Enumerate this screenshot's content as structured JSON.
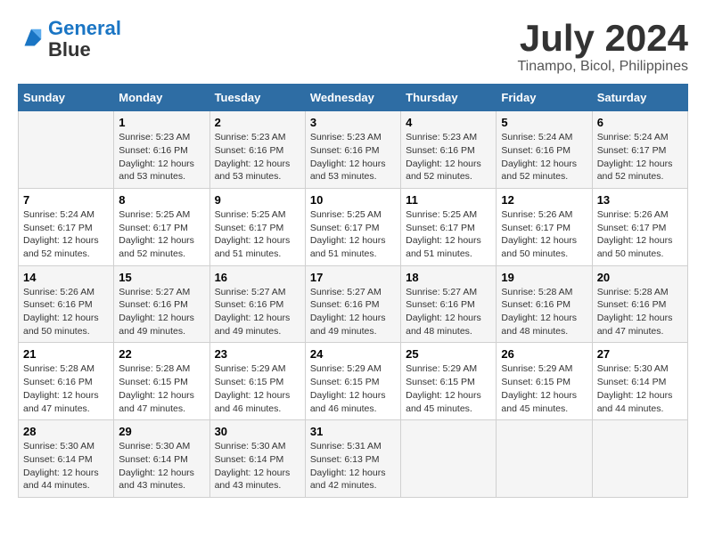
{
  "header": {
    "logo_line1": "General",
    "logo_line2": "Blue",
    "month": "July 2024",
    "location": "Tinampo, Bicol, Philippines"
  },
  "columns": [
    "Sunday",
    "Monday",
    "Tuesday",
    "Wednesday",
    "Thursday",
    "Friday",
    "Saturday"
  ],
  "weeks": [
    [
      {
        "day": "",
        "sunrise": "",
        "sunset": "",
        "daylight": ""
      },
      {
        "day": "1",
        "sunrise": "Sunrise: 5:23 AM",
        "sunset": "Sunset: 6:16 PM",
        "daylight": "Daylight: 12 hours and 53 minutes."
      },
      {
        "day": "2",
        "sunrise": "Sunrise: 5:23 AM",
        "sunset": "Sunset: 6:16 PM",
        "daylight": "Daylight: 12 hours and 53 minutes."
      },
      {
        "day": "3",
        "sunrise": "Sunrise: 5:23 AM",
        "sunset": "Sunset: 6:16 PM",
        "daylight": "Daylight: 12 hours and 53 minutes."
      },
      {
        "day": "4",
        "sunrise": "Sunrise: 5:23 AM",
        "sunset": "Sunset: 6:16 PM",
        "daylight": "Daylight: 12 hours and 52 minutes."
      },
      {
        "day": "5",
        "sunrise": "Sunrise: 5:24 AM",
        "sunset": "Sunset: 6:16 PM",
        "daylight": "Daylight: 12 hours and 52 minutes."
      },
      {
        "day": "6",
        "sunrise": "Sunrise: 5:24 AM",
        "sunset": "Sunset: 6:17 PM",
        "daylight": "Daylight: 12 hours and 52 minutes."
      }
    ],
    [
      {
        "day": "7",
        "sunrise": "Sunrise: 5:24 AM",
        "sunset": "Sunset: 6:17 PM",
        "daylight": "Daylight: 12 hours and 52 minutes."
      },
      {
        "day": "8",
        "sunrise": "Sunrise: 5:25 AM",
        "sunset": "Sunset: 6:17 PM",
        "daylight": "Daylight: 12 hours and 52 minutes."
      },
      {
        "day": "9",
        "sunrise": "Sunrise: 5:25 AM",
        "sunset": "Sunset: 6:17 PM",
        "daylight": "Daylight: 12 hours and 51 minutes."
      },
      {
        "day": "10",
        "sunrise": "Sunrise: 5:25 AM",
        "sunset": "Sunset: 6:17 PM",
        "daylight": "Daylight: 12 hours and 51 minutes."
      },
      {
        "day": "11",
        "sunrise": "Sunrise: 5:25 AM",
        "sunset": "Sunset: 6:17 PM",
        "daylight": "Daylight: 12 hours and 51 minutes."
      },
      {
        "day": "12",
        "sunrise": "Sunrise: 5:26 AM",
        "sunset": "Sunset: 6:17 PM",
        "daylight": "Daylight: 12 hours and 50 minutes."
      },
      {
        "day": "13",
        "sunrise": "Sunrise: 5:26 AM",
        "sunset": "Sunset: 6:17 PM",
        "daylight": "Daylight: 12 hours and 50 minutes."
      }
    ],
    [
      {
        "day": "14",
        "sunrise": "Sunrise: 5:26 AM",
        "sunset": "Sunset: 6:16 PM",
        "daylight": "Daylight: 12 hours and 50 minutes."
      },
      {
        "day": "15",
        "sunrise": "Sunrise: 5:27 AM",
        "sunset": "Sunset: 6:16 PM",
        "daylight": "Daylight: 12 hours and 49 minutes."
      },
      {
        "day": "16",
        "sunrise": "Sunrise: 5:27 AM",
        "sunset": "Sunset: 6:16 PM",
        "daylight": "Daylight: 12 hours and 49 minutes."
      },
      {
        "day": "17",
        "sunrise": "Sunrise: 5:27 AM",
        "sunset": "Sunset: 6:16 PM",
        "daylight": "Daylight: 12 hours and 49 minutes."
      },
      {
        "day": "18",
        "sunrise": "Sunrise: 5:27 AM",
        "sunset": "Sunset: 6:16 PM",
        "daylight": "Daylight: 12 hours and 48 minutes."
      },
      {
        "day": "19",
        "sunrise": "Sunrise: 5:28 AM",
        "sunset": "Sunset: 6:16 PM",
        "daylight": "Daylight: 12 hours and 48 minutes."
      },
      {
        "day": "20",
        "sunrise": "Sunrise: 5:28 AM",
        "sunset": "Sunset: 6:16 PM",
        "daylight": "Daylight: 12 hours and 47 minutes."
      }
    ],
    [
      {
        "day": "21",
        "sunrise": "Sunrise: 5:28 AM",
        "sunset": "Sunset: 6:16 PM",
        "daylight": "Daylight: 12 hours and 47 minutes."
      },
      {
        "day": "22",
        "sunrise": "Sunrise: 5:28 AM",
        "sunset": "Sunset: 6:15 PM",
        "daylight": "Daylight: 12 hours and 47 minutes."
      },
      {
        "day": "23",
        "sunrise": "Sunrise: 5:29 AM",
        "sunset": "Sunset: 6:15 PM",
        "daylight": "Daylight: 12 hours and 46 minutes."
      },
      {
        "day": "24",
        "sunrise": "Sunrise: 5:29 AM",
        "sunset": "Sunset: 6:15 PM",
        "daylight": "Daylight: 12 hours and 46 minutes."
      },
      {
        "day": "25",
        "sunrise": "Sunrise: 5:29 AM",
        "sunset": "Sunset: 6:15 PM",
        "daylight": "Daylight: 12 hours and 45 minutes."
      },
      {
        "day": "26",
        "sunrise": "Sunrise: 5:29 AM",
        "sunset": "Sunset: 6:15 PM",
        "daylight": "Daylight: 12 hours and 45 minutes."
      },
      {
        "day": "27",
        "sunrise": "Sunrise: 5:30 AM",
        "sunset": "Sunset: 6:14 PM",
        "daylight": "Daylight: 12 hours and 44 minutes."
      }
    ],
    [
      {
        "day": "28",
        "sunrise": "Sunrise: 5:30 AM",
        "sunset": "Sunset: 6:14 PM",
        "daylight": "Daylight: 12 hours and 44 minutes."
      },
      {
        "day": "29",
        "sunrise": "Sunrise: 5:30 AM",
        "sunset": "Sunset: 6:14 PM",
        "daylight": "Daylight: 12 hours and 43 minutes."
      },
      {
        "day": "30",
        "sunrise": "Sunrise: 5:30 AM",
        "sunset": "Sunset: 6:14 PM",
        "daylight": "Daylight: 12 hours and 43 minutes."
      },
      {
        "day": "31",
        "sunrise": "Sunrise: 5:31 AM",
        "sunset": "Sunset: 6:13 PM",
        "daylight": "Daylight: 12 hours and 42 minutes."
      },
      {
        "day": "",
        "sunrise": "",
        "sunset": "",
        "daylight": ""
      },
      {
        "day": "",
        "sunrise": "",
        "sunset": "",
        "daylight": ""
      },
      {
        "day": "",
        "sunrise": "",
        "sunset": "",
        "daylight": ""
      }
    ]
  ]
}
